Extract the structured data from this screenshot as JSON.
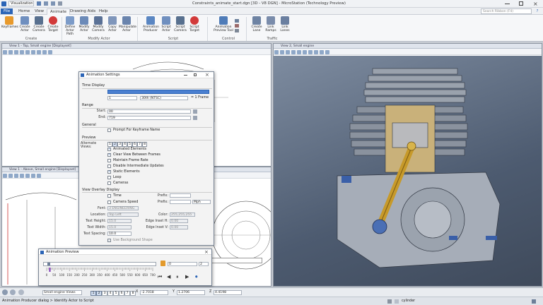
{
  "app": {
    "workflow": "Visualization",
    "title": "Constraints_animate_start.dgn [3D - V8 DGN] - MicroStation (Technology Preview)",
    "search_placeholder": "Search Ribbon (F4)"
  },
  "ribbon": {
    "tabs": [
      "File",
      "Home",
      "View",
      "Animate",
      "Drawing Aids",
      "Help"
    ],
    "active_tab": "Animate",
    "groups": [
      {
        "label": "Create",
        "buttons": [
          "Keyframes",
          "Create Actor",
          "Create Camera",
          "Create Target"
        ]
      },
      {
        "label": "Modify Actor",
        "buttons": [
          "Define Actor Path",
          "Modify Actor",
          "Modify Camera",
          "Copy Actor",
          "Manipulate Actor"
        ]
      },
      {
        "label": "Script",
        "buttons": [
          "Animation Producer",
          "Script Actor",
          "Script Camera",
          "Script Target"
        ]
      },
      {
        "label": "Control",
        "buttons": [
          "Animation Preview Tool"
        ]
      },
      {
        "label": "Traffic",
        "buttons": [
          "Create Lane",
          "Link Ramps",
          "Link Lanes"
        ]
      }
    ]
  },
  "views": {
    "top": "View 1 - Top, Small engine [Displayset]",
    "left": "View 1 - Above, Small engine [Displayset]",
    "right": "View 2, Small engine"
  },
  "animation_settings": {
    "title": "Animation Settings",
    "time_display": {
      "label": "Time Display",
      "fps_value": "1",
      "rate_value": "30th (NTSC)",
      "frame_suffix": "= 1 Frame"
    },
    "range": {
      "label": "Range",
      "start_label": "Start:",
      "start_value": "00",
      "end_label": "End:",
      "end_value": "719"
    },
    "general": {
      "label": "General",
      "prompt_keyframe": "Prompt For Keyframe Name"
    },
    "preview": {
      "label": "Preview",
      "alt_views_label": "Alternate Views:",
      "view_numbers": [
        "1",
        "2",
        "3",
        "4",
        "5",
        "6",
        "7",
        "8"
      ],
      "options": [
        {
          "label": "Animated Elements",
          "checked": true
        },
        {
          "label": "Clear View Between Frames",
          "checked": true
        },
        {
          "label": "Maintain Frame Rate",
          "checked": false
        },
        {
          "label": "Disable Intermediate Updates",
          "checked": false
        },
        {
          "label": "Static Elements",
          "checked": true
        },
        {
          "label": "Loop",
          "checked": false
        },
        {
          "label": "Cameras",
          "checked": false
        }
      ]
    },
    "overlay": {
      "label": "View Overlay Display",
      "time_label": "Time",
      "camera_speed_label": "Camera Speed",
      "prefix_label": "Prefix:",
      "speed_unit": "Mph",
      "font_label": "Font:",
      "font_value": "3 ENGINEERING",
      "color_label": "Color:",
      "color_value": "255,255,255",
      "location_label": "Location:",
      "location_value": "Top Left",
      "text_height_label": "Text Height:",
      "text_height_value": "15.0",
      "text_width_label": "Text Width:",
      "text_width_value": "15.0",
      "edge_h_label": "Edge Inset H:",
      "edge_h_value": "0.00",
      "edge_v_label": "Edge Inset V:",
      "edge_v_value": "0.00",
      "spacing_label": "Text Spacing:",
      "spacing_value": "10.0",
      "background_label": "Use Background Shape"
    }
  },
  "animation_preview": {
    "title": "Animation Preview",
    "frame_value": "0",
    "step_value": "2",
    "progress": 0.03,
    "ticks": [
      "0",
      "50",
      "100",
      "150",
      "200",
      "250",
      "300",
      "350",
      "400",
      "450",
      "500",
      "550",
      "600",
      "650",
      "700"
    ]
  },
  "statusbar": {
    "view_group": "Small engine Views",
    "view_buttons": [
      "1",
      "2",
      "3",
      "4",
      "5",
      "6",
      "7",
      "8"
    ],
    "x_label": "X",
    "x_value": "-2.7018",
    "y_label": "Y",
    "y_value": "1.2706",
    "z_label": "Z",
    "z_value": "4.4198",
    "level": "cylinder"
  },
  "message": "Animation Producer dialog > Identify Actor to Script",
  "colors": {
    "accent": "#2b64b6",
    "viewport_bg": "#5d6e86"
  }
}
